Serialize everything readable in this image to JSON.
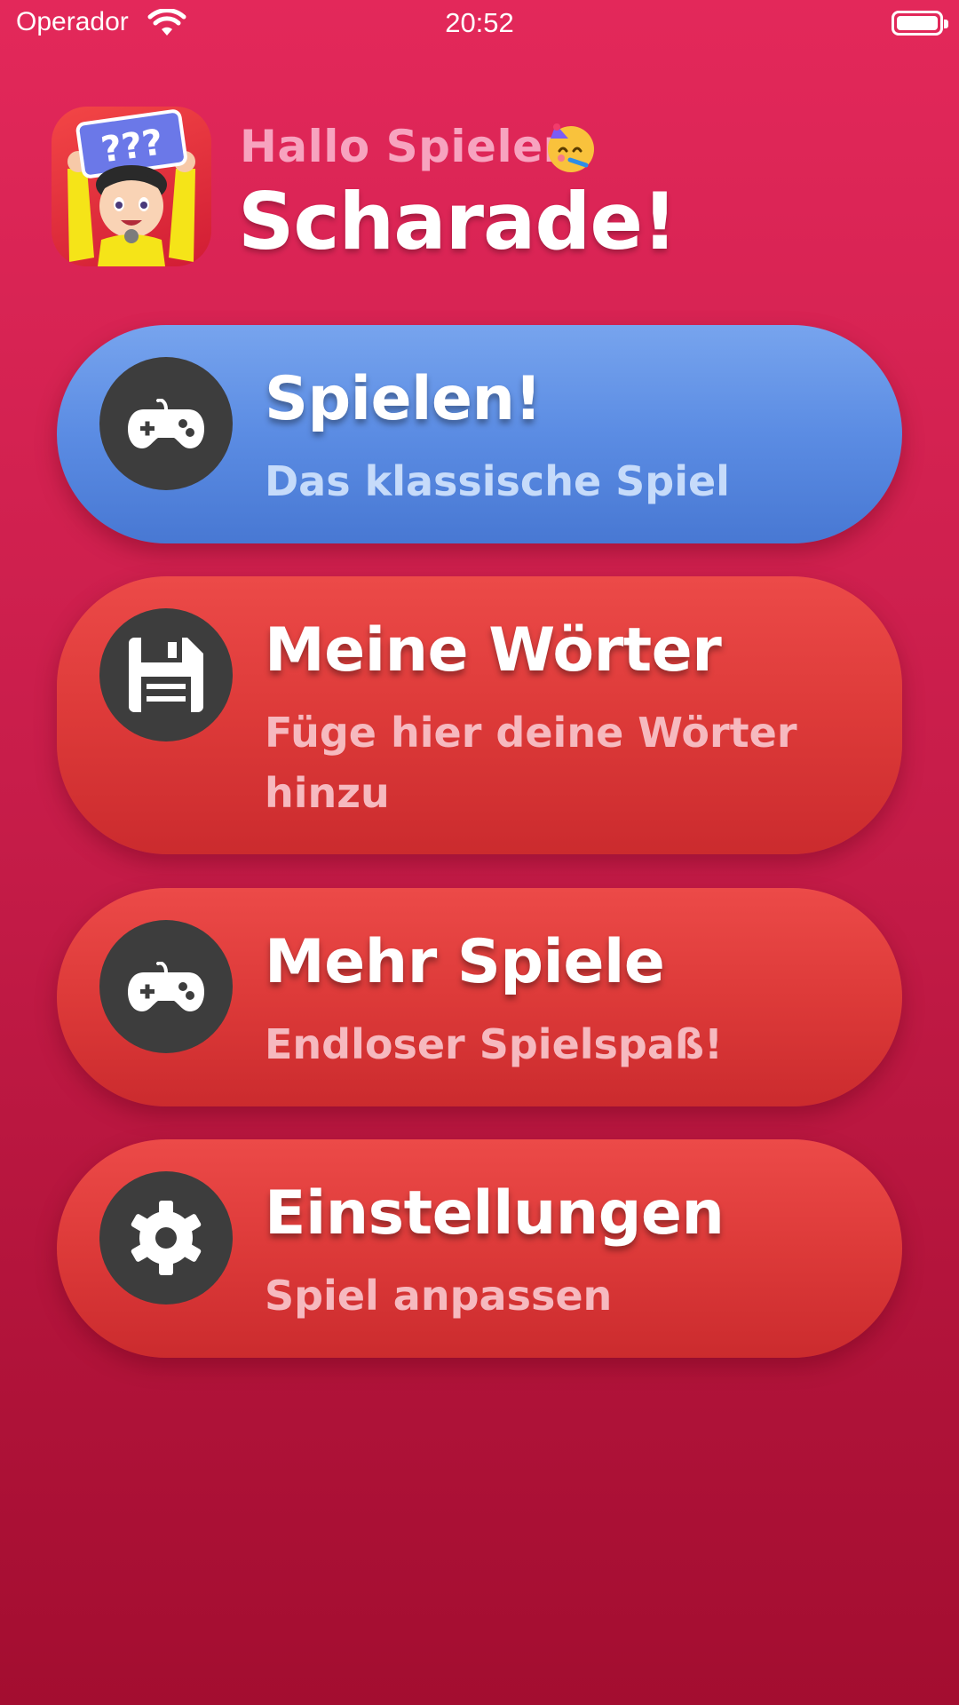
{
  "status_bar": {
    "carrier": "Operador",
    "time": "20:52",
    "wifi_icon": "wifi-icon",
    "battery_icon": "battery-icon"
  },
  "header": {
    "app_icon": "charades-app-icon",
    "greeting": "Hallo Spieler!",
    "greeting_emoji": "party-face-emoji",
    "title": "Scharade!"
  },
  "menu": [
    {
      "icon": "gamepad-icon",
      "label": "Spielen!",
      "subtitle": "Das klassische Spiel",
      "color": "#5b8ce3"
    },
    {
      "icon": "floppy-disk-icon",
      "label": "Meine Wörter",
      "subtitle": "Füge hier deine Wörter hinzu",
      "color": "#dd3a39"
    },
    {
      "icon": "gamepad-icon",
      "label": "Mehr Spiele",
      "subtitle": "Endloser Spielspaß!",
      "color": "#dd3a39"
    },
    {
      "icon": "gear-icon",
      "label": "Einstellungen",
      "subtitle": "Spiel anpassen",
      "color": "#dd3a39"
    }
  ],
  "colors": {
    "background_top": "#e3285a",
    "background_bottom": "#a30d30",
    "icon_circle": "#3d3d3d"
  }
}
